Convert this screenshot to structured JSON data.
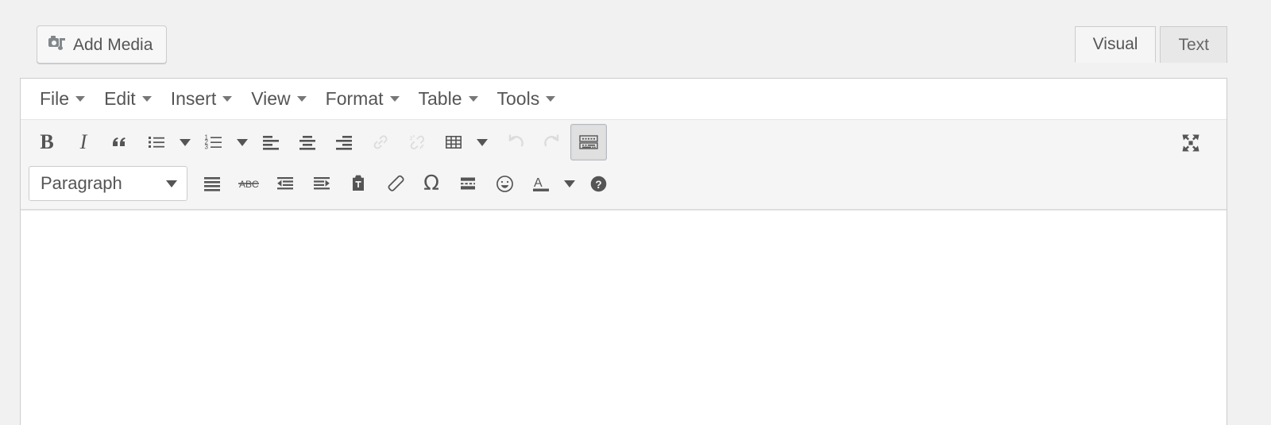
{
  "editor": {
    "add_media": {
      "label": "Add Media",
      "icon": "add-media-icon"
    },
    "tabs": [
      {
        "label": "Visual",
        "name": "tab-visual",
        "active": true
      },
      {
        "label": "Text",
        "name": "tab-text",
        "active": false
      }
    ],
    "menubar": [
      {
        "label": "File",
        "name": "menu-file"
      },
      {
        "label": "Edit",
        "name": "menu-edit"
      },
      {
        "label": "Insert",
        "name": "menu-insert"
      },
      {
        "label": "View",
        "name": "menu-view"
      },
      {
        "label": "Format",
        "name": "menu-format"
      },
      {
        "label": "Table",
        "name": "menu-table"
      },
      {
        "label": "Tools",
        "name": "menu-tools"
      }
    ],
    "toolbar_row1": [
      {
        "name": "bold-button",
        "icon": "bold-icon",
        "glyph": "B",
        "title": "Bold"
      },
      {
        "name": "italic-button",
        "icon": "italic-icon",
        "glyph": "I",
        "title": "Italic"
      },
      {
        "name": "blockquote-button",
        "icon": "blockquote-icon",
        "glyph": "“",
        "title": "Blockquote"
      },
      {
        "name": "bullet-list-button",
        "icon": "bullet-list-icon",
        "title": "Bulleted list"
      },
      {
        "name": "bullet-list-dropdown",
        "icon": "chevron-down-icon",
        "title": "Bulleted list options"
      },
      {
        "name": "numbered-list-button",
        "icon": "numbered-list-icon",
        "title": "Numbered list"
      },
      {
        "name": "numbered-list-dropdown",
        "icon": "chevron-down-icon",
        "title": "Numbered list options"
      },
      {
        "name": "align-left-button",
        "icon": "align-left-icon",
        "title": "Align left"
      },
      {
        "name": "align-center-button",
        "icon": "align-center-icon",
        "title": "Align center"
      },
      {
        "name": "align-right-button",
        "icon": "align-right-icon",
        "title": "Align right"
      },
      {
        "name": "insert-link-button",
        "icon": "link-icon",
        "title": "Insert/edit link",
        "disabled": true
      },
      {
        "name": "remove-link-button",
        "icon": "unlink-icon",
        "title": "Remove link",
        "disabled": true
      },
      {
        "name": "table-button",
        "icon": "table-icon",
        "title": "Table"
      },
      {
        "name": "table-dropdown",
        "icon": "chevron-down-icon",
        "title": "Table options"
      },
      {
        "name": "undo-button",
        "icon": "undo-icon",
        "title": "Undo",
        "disabled": true
      },
      {
        "name": "redo-button",
        "icon": "redo-icon",
        "title": "Redo",
        "disabled": true
      },
      {
        "name": "keyboard-shortcuts-button",
        "icon": "keyboard-icon",
        "title": "Keyboard Shortcuts",
        "active": true
      }
    ],
    "toolbar_row2": [
      {
        "name": "paragraph-format-select",
        "icon": "format-select",
        "value": "Paragraph",
        "title": "Paragraph"
      },
      {
        "name": "justify-button",
        "icon": "align-justify-icon",
        "title": "Justify"
      },
      {
        "name": "strikethrough-button",
        "icon": "strikethrough-icon",
        "glyph": "ABC",
        "title": "Strikethrough"
      },
      {
        "name": "outdent-button",
        "icon": "outdent-icon",
        "title": "Decrease indent"
      },
      {
        "name": "indent-button",
        "icon": "indent-icon",
        "title": "Increase indent"
      },
      {
        "name": "paste-as-text-button",
        "icon": "paste-text-icon",
        "title": "Paste as text"
      },
      {
        "name": "clear-formatting-button",
        "icon": "eraser-icon",
        "title": "Clear formatting"
      },
      {
        "name": "special-character-button",
        "icon": "omega-icon",
        "glyph": "Ω",
        "title": "Special character"
      },
      {
        "name": "read-more-button",
        "icon": "read-more-icon",
        "title": "Insert Read More tag"
      },
      {
        "name": "emoji-button",
        "icon": "smiley-icon",
        "title": "Emoji"
      },
      {
        "name": "text-color-button",
        "icon": "text-color-icon",
        "glyph": "A",
        "title": "Text color"
      },
      {
        "name": "text-color-dropdown",
        "icon": "chevron-down-icon",
        "title": "Text color options"
      },
      {
        "name": "help-button",
        "icon": "help-icon",
        "glyph": "?",
        "title": "Keyboard Shortcuts help"
      }
    ],
    "fullscreen_button": {
      "name": "distraction-free-button",
      "icon": "fullscreen-expand-icon",
      "title": "Distraction-free writing mode"
    },
    "content": {
      "text": "",
      "placeholder": ""
    }
  },
  "colors": {
    "page_background": "#f1f1f1",
    "panel_background": "#ffffff",
    "toolbar_background": "#f5f5f5",
    "border": "#cccccc",
    "icon": "#555555",
    "icon_disabled": "#c8c8c8",
    "text": "#555555",
    "active_tab_background": "#f5f5f5",
    "inactive_tab_background": "#e8e8e8"
  }
}
